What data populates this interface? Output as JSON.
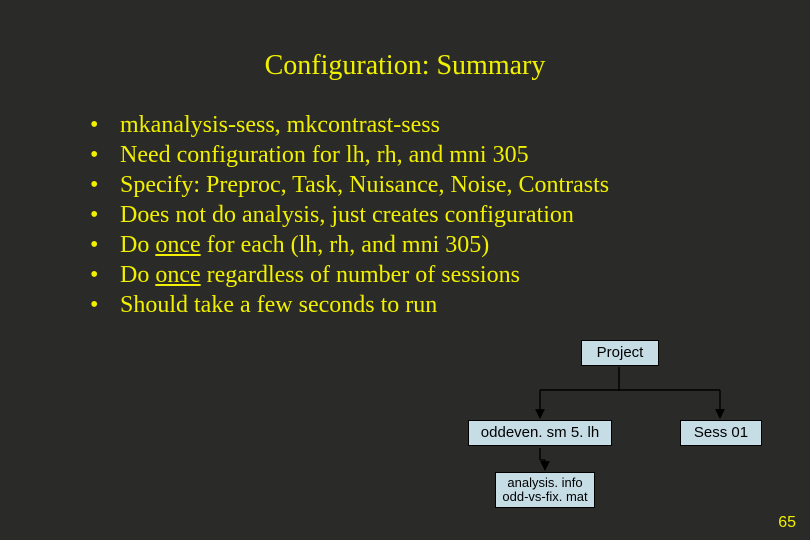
{
  "title": "Configuration: Summary",
  "bullets": [
    {
      "pre": "mkanalysis-sess, mkcontrast-sess",
      "u": "",
      "post": ""
    },
    {
      "pre": "Need configuration for lh, rh, and mni 305",
      "u": "",
      "post": ""
    },
    {
      "pre": "Specify: Preproc, Task, Nuisance, Noise, Contrasts",
      "u": "",
      "post": ""
    },
    {
      "pre": "Does not do analysis, just creates configuration",
      "u": "",
      "post": ""
    },
    {
      "pre": "Do ",
      "u": "once",
      "post": " for each (lh, rh, and mni 305)"
    },
    {
      "pre": "Do ",
      "u": "once",
      "post": " regardless of number of sessions"
    },
    {
      "pre": "Should take a few seconds to run",
      "u": "",
      "post": ""
    }
  ],
  "diagram": {
    "project": "Project",
    "oddeven": "oddeven. sm 5. lh",
    "sess": "Sess 01",
    "analysis_line1": "analysis. info",
    "analysis_line2": "odd-vs-fix. mat"
  },
  "page": "65"
}
